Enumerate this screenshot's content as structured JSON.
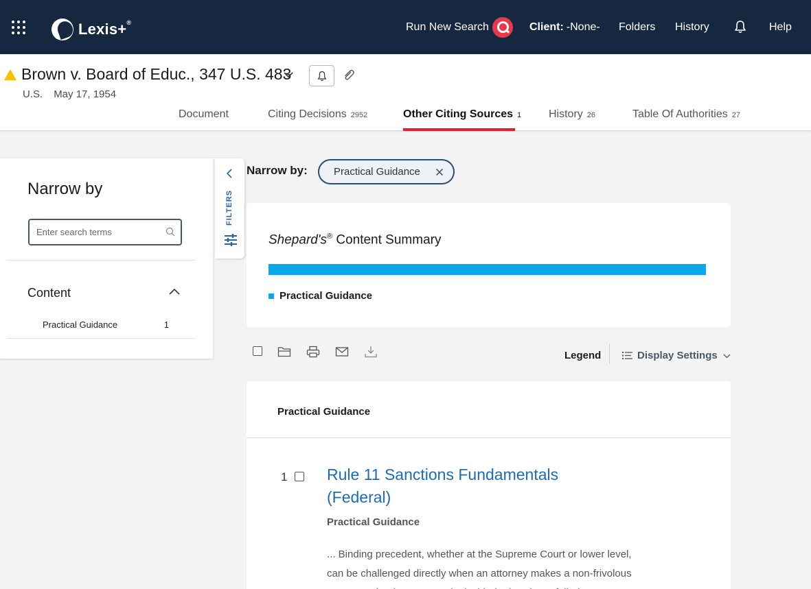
{
  "topbar": {
    "brand": "Lexis+",
    "brand_mark": "®",
    "run_new_search": "Run New Search",
    "client_label": "Client:",
    "client_value": "-None-",
    "folders": "Folders",
    "history": "History",
    "help": "Help",
    "bg_color": "#16283f",
    "search_accent": "#e8394a"
  },
  "case": {
    "title": "Brown v. Board of Educ., 347 U.S. 483",
    "court": "U.S.",
    "date": "May 17, 1954",
    "warning_color": "#f3c300"
  },
  "tabs": [
    {
      "label": "Document",
      "count": ""
    },
    {
      "label": "Citing Decisions",
      "count": "2952"
    },
    {
      "label": "Other Citing Sources",
      "count": "1",
      "active": true
    },
    {
      "label": "History",
      "count": "26"
    },
    {
      "label": "Table Of Authorities",
      "count": "27"
    }
  ],
  "sidebar": {
    "title": "Narrow by",
    "search_placeholder": "Enter search terms",
    "section_label": "Content",
    "facets": [
      {
        "label": "Practical Guidance",
        "count": "1"
      }
    ],
    "filters_label": "FILTERS"
  },
  "narrow": {
    "label": "Narrow by:",
    "chip": "Practical Guidance"
  },
  "summary": {
    "title_italic": "Shepard's",
    "title_mark": "®",
    "title_rest": " Content Summary",
    "legend_item": "Practical Guidance",
    "bar_fraction": 1.0,
    "bar_color": "#0ba7ec"
  },
  "toolbar": {
    "legend": "Legend",
    "display_settings": "Display Settings"
  },
  "results": {
    "group_header": "Practical Guidance",
    "items": [
      {
        "number": "1",
        "title": "Rule 11 Sanctions Fundamentals (Federal)",
        "type": "Practical Guidance",
        "snippet": "... Binding precedent, whether at the Supreme Court or lower level, can be challenged directly when an attorney makes a non-frivolous argument that it was wrongly decided. The \"that a failed attempt"
      }
    ],
    "link_color": "#1d6bb3"
  }
}
